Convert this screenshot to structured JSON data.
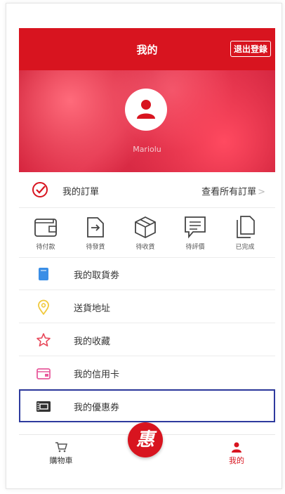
{
  "header": {
    "title": "我的",
    "logout_label": "退出登錄"
  },
  "profile": {
    "username": "Mariolu"
  },
  "orders": {
    "label": "我的訂單",
    "view_all": "查看所有訂單",
    "chevron": ">"
  },
  "order_status": [
    {
      "label": "待付款",
      "icon": "wallet-icon"
    },
    {
      "label": "待發貨",
      "icon": "ship-icon"
    },
    {
      "label": "待收貨",
      "icon": "package-icon"
    },
    {
      "label": "待評價",
      "icon": "review-icon"
    },
    {
      "label": "已完成",
      "icon": "completed-icon"
    }
  ],
  "menu": [
    {
      "label": "我的取貨劵",
      "icon": "pickup-coupon-icon",
      "color": "#3a8ee6"
    },
    {
      "label": "送貨地址",
      "icon": "location-pin-icon",
      "color": "#f0c93c"
    },
    {
      "label": "我的收藏",
      "icon": "star-icon",
      "color": "#e8485a"
    },
    {
      "label": "我的信用卡",
      "icon": "credit-card-icon",
      "color": "#e85a9c"
    },
    {
      "label": "我的優惠券",
      "icon": "coupon-icon",
      "color": "#333333"
    }
  ],
  "tabbar": {
    "cart_label": "購物車",
    "center_label": "惠",
    "me_label": "我的"
  },
  "colors": {
    "brand": "#d8141f",
    "highlight_border": "#2e3a9e"
  }
}
